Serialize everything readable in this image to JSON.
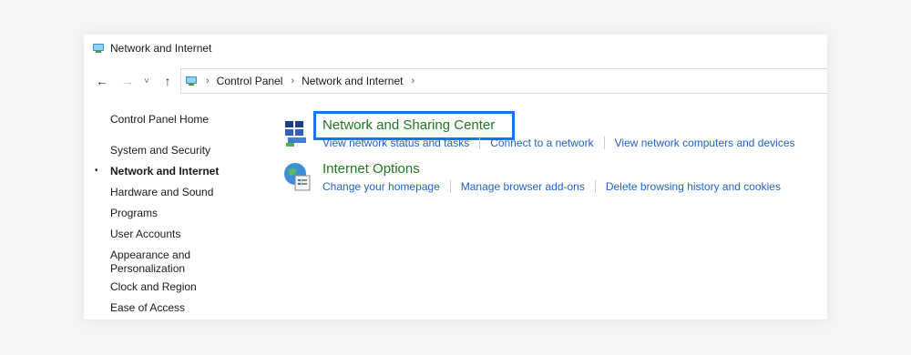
{
  "window": {
    "title": "Network and Internet"
  },
  "address_bar": {
    "crumbs": [
      "Control Panel",
      "Network and Internet"
    ],
    "separator": "›"
  },
  "nav": {
    "back": "←",
    "forward": "→",
    "recent": "˅",
    "up": "↑"
  },
  "sidebar": {
    "home": "Control Panel Home",
    "bullet": "•",
    "items": [
      {
        "label": "System and Security"
      },
      {
        "label": "Network and Internet",
        "current": true
      },
      {
        "label": "Hardware and Sound"
      },
      {
        "label": "Programs"
      },
      {
        "label": "User Accounts"
      },
      {
        "label": "Appearance and Personalization"
      },
      {
        "label": "Clock and Region"
      },
      {
        "label": "Ease of Access"
      }
    ]
  },
  "categories": [
    {
      "title": "Network and Sharing Center",
      "icon": "network-sharing-icon",
      "highlighted": true,
      "links": [
        "View network status and tasks",
        "Connect to a network",
        "View network computers and devices"
      ]
    },
    {
      "title": "Internet Options",
      "icon": "internet-options-icon",
      "links": [
        "Change your homepage",
        "Manage browser add-ons",
        "Delete browsing history and cookies"
      ]
    }
  ],
  "colors": {
    "title_green": "#1e7a1e",
    "link_blue": "#1f63c4",
    "highlight_border": "#1a73e8"
  }
}
